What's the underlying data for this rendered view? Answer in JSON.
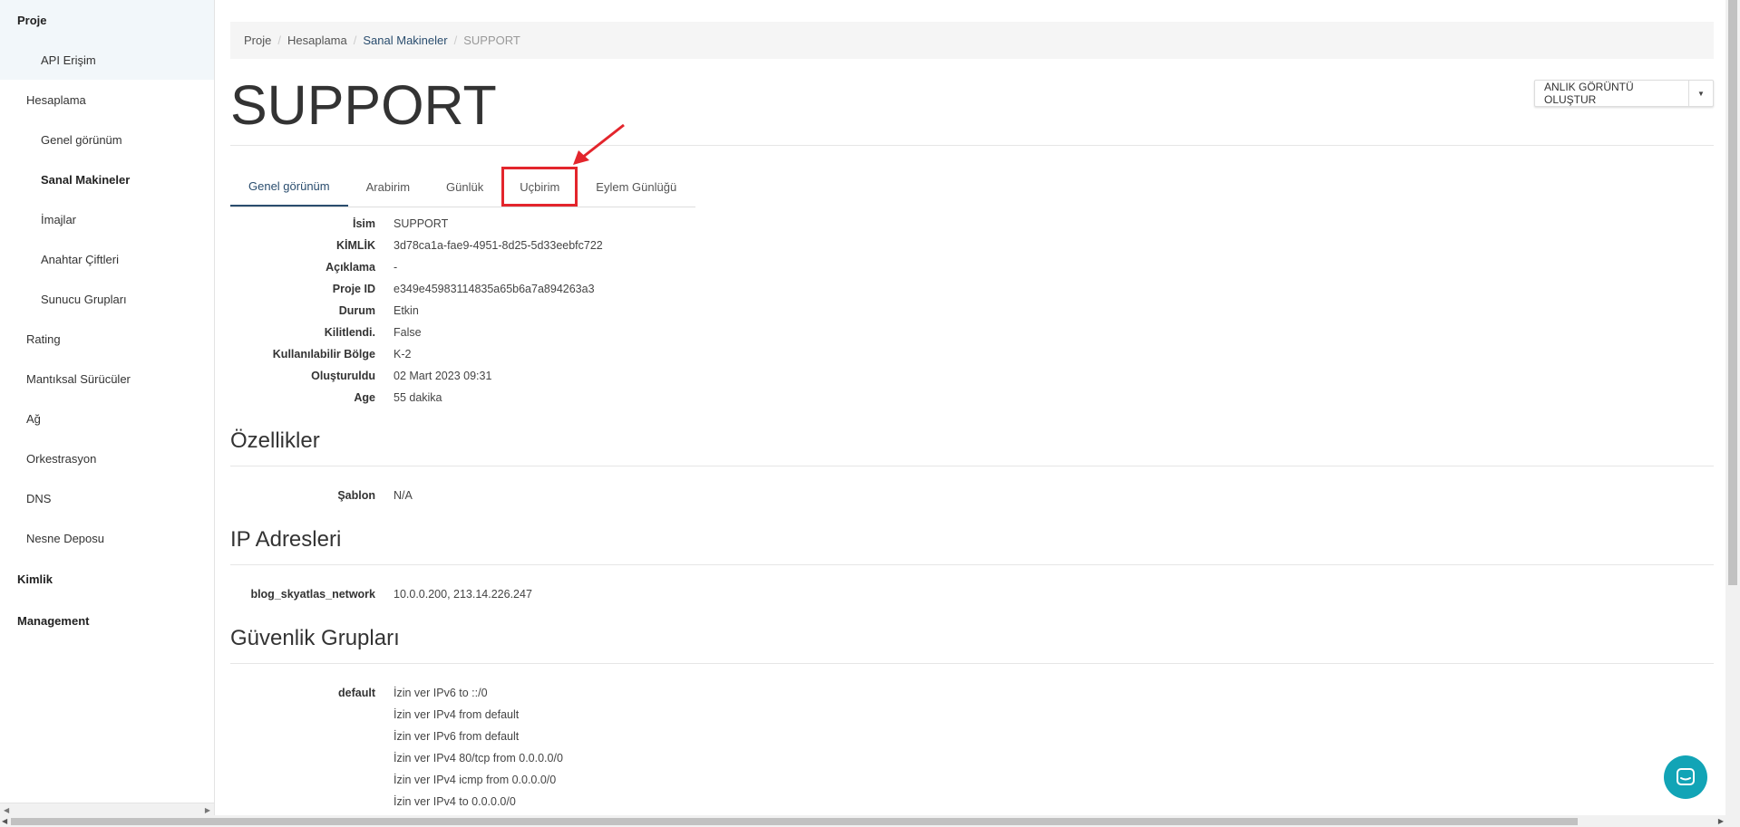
{
  "sidebar": {
    "proje": "Proje",
    "api_erisim": "API Erişim",
    "hesaplama": "Hesaplama",
    "genel_gorunum": "Genel görünüm",
    "sanal_makineler": "Sanal Makineler",
    "imajlar": "İmajlar",
    "anahtar_ciftleri": "Anahtar Çiftleri",
    "sunucu_gruplari": "Sunucu Grupları",
    "rating": "Rating",
    "mantiksal_suruculer": "Mantıksal Sürücüler",
    "ag": "Ağ",
    "orkestrasyon": "Orkestrasyon",
    "dns": "DNS",
    "nesne_deposu": "Nesne Deposu",
    "kimlik": "Kimlik",
    "management": "Management"
  },
  "breadcrumb": {
    "proje": "Proje",
    "hesaplama": "Hesaplama",
    "sanal_makineler": "Sanal Makineler",
    "current": "SUPPORT",
    "sep": "/"
  },
  "page_title": "SUPPORT",
  "actions": {
    "snapshot_label": "ANLIK GÖRÜNTÜ OLUŞTUR"
  },
  "tabs": {
    "overview": "Genel görünüm",
    "interface": "Arabirim",
    "log": "Günlük",
    "console": "Uçbirim",
    "action_log": "Eylem Günlüğü"
  },
  "overview": {
    "isim_k": "İsim",
    "isim_v": "SUPPORT",
    "kimlik_k": "KİMLİK",
    "kimlik_v": "3d78ca1a-fae9-4951-8d25-5d33eebfc722",
    "aciklama_k": "Açıklama",
    "aciklama_v": "-",
    "proje_id_k": "Proje ID",
    "proje_id_v": "e349e45983114835a65b6a7a894263a3",
    "durum_k": "Durum",
    "durum_v": "Etkin",
    "kilit_k": "Kilitlendi.",
    "kilit_v": "False",
    "bolge_k": "Kullanılabilir Bölge",
    "bolge_v": "K-2",
    "olusturuldu_k": "Oluşturuldu",
    "olusturuldu_v": "02 Mart 2023 09:31",
    "age_k": "Age",
    "age_v": "55 dakika"
  },
  "specs": {
    "title": "Özellikler",
    "sablon_k": "Şablon",
    "sablon_v": "N/A"
  },
  "ip": {
    "title": "IP Adresleri",
    "network_k": "blog_skyatlas_network",
    "network_v": "10.0.0.200,  213.14.226.247"
  },
  "security": {
    "title": "Güvenlik Grupları",
    "group_k": "default",
    "rules": [
      "İzin ver IPv6 to ::/0",
      "İzin ver IPv4 from default",
      "İzin ver IPv6 from default",
      "İzin ver IPv4 80/tcp from 0.0.0.0/0",
      "İzin ver IPv4 icmp from 0.0.0.0/0",
      "İzin ver IPv4 to 0.0.0.0/0"
    ]
  },
  "colors": {
    "accent": "#2a4d6e",
    "highlight": "#e3252c",
    "chat": "#12a4b6"
  },
  "icons": {
    "chat": "chat-icon",
    "caret": "caret-down-icon",
    "arrow": "annotation-arrow-icon"
  }
}
